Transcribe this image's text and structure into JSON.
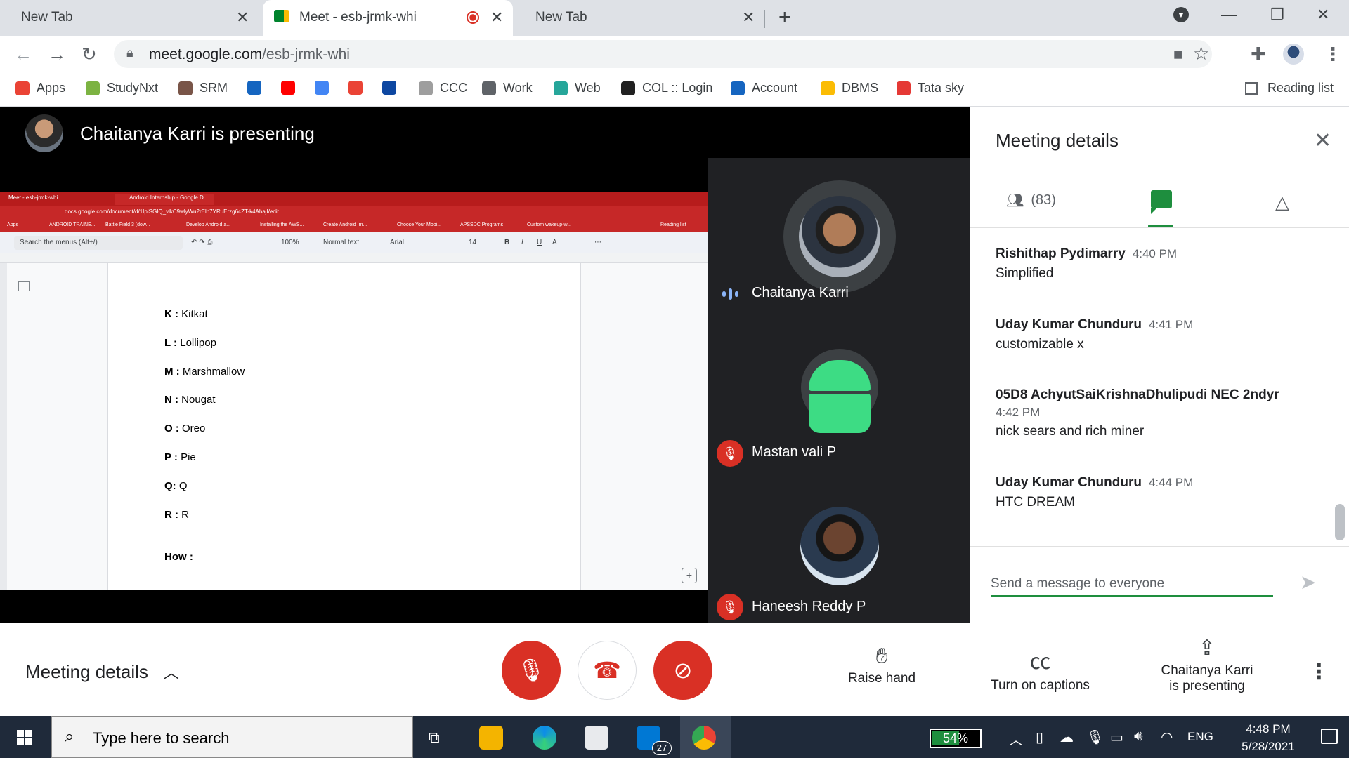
{
  "browser": {
    "tabs": [
      {
        "title": "New Tab"
      },
      {
        "title": "Meet - esb-jrmk-whi"
      },
      {
        "title": "New Tab"
      }
    ],
    "url_host": "meet.google.com",
    "url_path": "/esb-jrmk-whi",
    "bookmarks": [
      {
        "label": "Apps",
        "color": "#ea4335"
      },
      {
        "label": "StudyNxt",
        "color": "#7cb342"
      },
      {
        "label": "SRM",
        "color": "#795548"
      },
      {
        "label": "",
        "color": "#1565c0"
      },
      {
        "label": "",
        "color": "#ff0000"
      },
      {
        "label": "",
        "color": "#4285f4"
      },
      {
        "label": "",
        "color": "#ea4335"
      },
      {
        "label": "",
        "color": "#0d47a1"
      },
      {
        "label": "CCC",
        "color": "#9e9e9e"
      },
      {
        "label": "Work",
        "color": "#5f6368"
      },
      {
        "label": "Web",
        "color": "#26a69a"
      },
      {
        "label": "COL :: Login",
        "color": "#212121"
      },
      {
        "label": "Account",
        "color": "#1565c0"
      },
      {
        "label": "DBMS",
        "color": "#fbbc04"
      },
      {
        "label": "Tata sky",
        "color": "#e53935"
      }
    ],
    "reading_list": "Reading list"
  },
  "meet": {
    "presenting_title": "Chaitanya Karri is presenting",
    "shared_screen": {
      "tabs": [
        "Meet - esb-jrmk-whi",
        "Android Internship - Google D..."
      ],
      "url": "docs.google.com/document/d/1IpiSGIQ_vlkC9wlyWu2rElh7YRuErzg6cZT-k4AhajI/edit",
      "bookmarks": [
        "Apps",
        "ANDROID TRAINE...",
        "Battle Field 3 (dow...",
        "Develop Android a...",
        "Installing the AWS...",
        "Create Android Im...",
        "Choose Your Mobi...",
        "APSSDC Programs",
        "Custom wakeup-w...",
        "Reading list"
      ],
      "search_menus": "Search the menus (Alt+/)",
      "zoom": "100%",
      "style": "Normal text",
      "font": "Arial",
      "font_size": "14",
      "lines": [
        {
          "key": "K :",
          "val": " Kitkat"
        },
        {
          "key": "L :",
          "val": " Lollipop"
        },
        {
          "key": "M :",
          "val": " Marshmallow"
        },
        {
          "key": "N :",
          "val": " Nougat"
        },
        {
          "key": "O :",
          "val": " Oreo"
        },
        {
          "key": "P :",
          "val": " Pie"
        },
        {
          "key": "Q:",
          "val": " Q"
        },
        {
          "key": "R :",
          "val": " R"
        },
        {
          "key": "How :",
          "val": ""
        }
      ]
    },
    "participants": [
      {
        "name": "Chaitanya Karri",
        "state": "speaking"
      },
      {
        "name": "Mastan vali P",
        "state": "muted"
      },
      {
        "name": "Haneesh Reddy P",
        "state": "muted"
      }
    ]
  },
  "panel": {
    "title": "Meeting details",
    "people_count": "(83)",
    "messages": [
      {
        "sender": "Rishithap Pydimarry",
        "time": "4:40 PM",
        "text": "Simplified"
      },
      {
        "sender": "Uday Kumar Chunduru",
        "time": "4:41 PM",
        "text": "customizable x"
      },
      {
        "sender": "05D8 AchyutSaiKrishnaDhulipudi NEC 2ndyr",
        "time": "4:42 PM",
        "text": "nick sears and rich miner"
      },
      {
        "sender": "Uday Kumar Chunduru",
        "time": "4:44 PM",
        "text": "HTC DREAM"
      }
    ],
    "input_placeholder": "Send a message to everyone"
  },
  "controls": {
    "meeting_details": "Meeting details",
    "raise_hand": "Raise hand",
    "captions": "Turn on captions",
    "presenting_line1": "Chaitanya Karri",
    "presenting_line2": "is presenting"
  },
  "taskbar": {
    "search_placeholder": "Type here to search",
    "battery": "54%",
    "mail_badge": "27",
    "language": "ENG",
    "time": "4:48 PM",
    "date": "5/28/2021"
  }
}
